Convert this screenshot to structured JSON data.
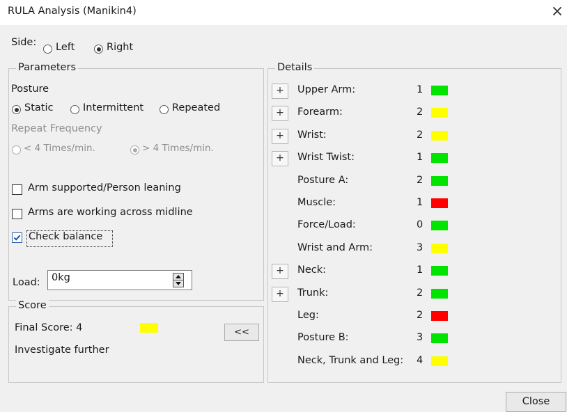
{
  "window": {
    "title": "RULA Analysis (Manikin4)",
    "close_glyph": "×"
  },
  "side": {
    "label": "Side:",
    "options": [
      "Left",
      "Right"
    ],
    "selected": "Right"
  },
  "parameters": {
    "group_label": "Parameters",
    "posture_label": "Posture",
    "posture_options": [
      "Static",
      "Intermittent",
      "Repeated"
    ],
    "posture_selected": "Static",
    "repeat_label": "Repeat Frequency",
    "repeat_options": [
      "< 4 Times/min.",
      "> 4 Times/min."
    ],
    "repeat_selected": "> 4 Times/min.",
    "checkboxes": [
      {
        "label": "Arm supported/Person leaning",
        "checked": false
      },
      {
        "label": "Arms are working across midline",
        "checked": false
      },
      {
        "label": "Check balance",
        "checked": true
      }
    ],
    "load_label": "Load:",
    "load_value": "0kg"
  },
  "score": {
    "group_label": "Score",
    "final_label": "Final Score: 4",
    "final_color": "#ffff00",
    "message": "Investigate further",
    "collapse_button": "<<"
  },
  "details": {
    "group_label": "Details",
    "rows": [
      {
        "label": "Upper Arm:",
        "value": "1",
        "color": "#00e400",
        "expandable": true
      },
      {
        "label": "Forearm:",
        "value": "2",
        "color": "#ffff00",
        "expandable": true
      },
      {
        "label": "Wrist:",
        "value": "2",
        "color": "#ffff00",
        "expandable": true
      },
      {
        "label": "Wrist Twist:",
        "value": "1",
        "color": "#00e400",
        "expandable": true
      },
      {
        "label": "Posture A:",
        "value": "2",
        "color": "#00e400",
        "expandable": false
      },
      {
        "label": "Muscle:",
        "value": "1",
        "color": "#ff0000",
        "expandable": false
      },
      {
        "label": "Force/Load:",
        "value": "0",
        "color": "#00e400",
        "expandable": false
      },
      {
        "label": "Wrist and Arm:",
        "value": "3",
        "color": "#ffff00",
        "expandable": false
      },
      {
        "label": "Neck:",
        "value": "1",
        "color": "#00e400",
        "expandable": true
      },
      {
        "label": "Trunk:",
        "value": "2",
        "color": "#00e400",
        "expandable": true
      },
      {
        "label": "Leg:",
        "value": "2",
        "color": "#ff0000",
        "expandable": false
      },
      {
        "label": "Posture B:",
        "value": "3",
        "color": "#00e400",
        "expandable": false
      },
      {
        "label": "Neck, Trunk and Leg:",
        "value": "4",
        "color": "#ffff00",
        "expandable": false
      }
    ],
    "expand_glyph": "+"
  },
  "footer": {
    "close_button": "Close"
  }
}
